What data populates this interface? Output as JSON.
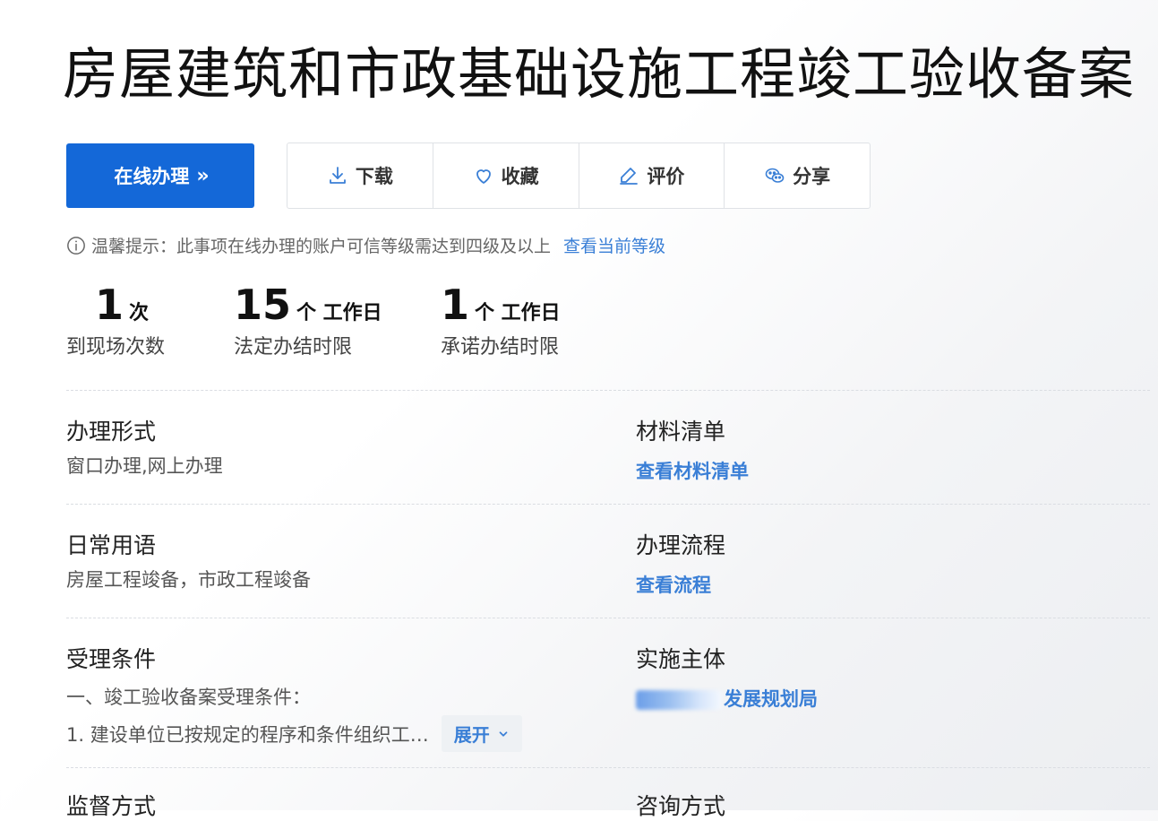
{
  "title": "房屋建筑和市政基础设施工程竣工验收备案",
  "primary_button": {
    "label": "在线办理",
    "chevron": "»"
  },
  "actions": [
    {
      "label": "下载",
      "icon": "download-icon"
    },
    {
      "label": "收藏",
      "icon": "heart-icon"
    },
    {
      "label": "评价",
      "icon": "edit-icon"
    },
    {
      "label": "分享",
      "icon": "wechat-icon"
    }
  ],
  "tip": {
    "text": "温馨提示：此事项在线办理的账户可信等级需达到四级及以上",
    "link": "查看当前等级"
  },
  "stats": [
    {
      "value": "1",
      "unit": "次",
      "label": "到现场次数"
    },
    {
      "value": "15",
      "unit": "个 工作日",
      "label": "法定办结时限"
    },
    {
      "value": "1",
      "unit": "个 工作日",
      "label": "承诺办结时限"
    }
  ],
  "fields": {
    "form": {
      "label": "办理形式",
      "value": "窗口办理,网上办理"
    },
    "materials": {
      "label": "材料清单",
      "link": "查看材料清单"
    },
    "terms": {
      "label": "日常用语",
      "value": "房屋工程竣备，市政工程竣备"
    },
    "process": {
      "label": "办理流程",
      "link": "查看流程"
    },
    "conditions": {
      "label": "受理条件",
      "line1": "一、竣工验收备案受理条件：",
      "line2": "1. 建设单位已按规定的程序和条件组织工…",
      "expand": "展开"
    },
    "agency": {
      "label": "实施主体",
      "link": "发展规划局"
    },
    "supervision": {
      "label": "监督方式"
    },
    "consult": {
      "label": "咨询方式"
    }
  },
  "colors": {
    "primary": "#1468d8",
    "link": "#3a7fd6"
  }
}
